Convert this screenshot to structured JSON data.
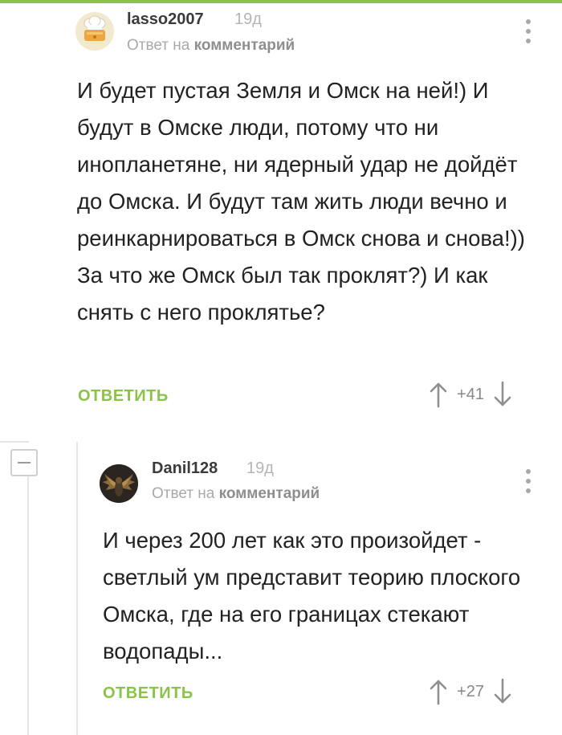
{
  "comments": [
    {
      "author": "lasso2007",
      "time": "19д",
      "reply_prefix": "Ответ на",
      "reply_link": "комментарий",
      "text": "И будет пустая Земля и Омск на ней!) И будут в Омске люди, потому что ни инопланетяне, ни ядерный удар не дойдёт до Омска. И будут там жить люди вечно и реинкарнироваться в Омск снова и снова!)) За что же Омск был так проклят?) И как снять с него проклятье?",
      "reply_button": "ОТВЕТИТЬ",
      "score": "+41",
      "avatar_icon": "chef-hat-avatar-icon"
    },
    {
      "author": "Danil128",
      "time": "19д",
      "reply_prefix": "Ответ на",
      "reply_link": "комментарий",
      "text": "И через 200 лет как это произойдет - светлый ум представит теорию плоского Омска, где на его границах стекают водопады...",
      "reply_button": "ОТВЕТИТЬ",
      "score": "+27",
      "avatar_icon": "winged-creature-avatar-icon"
    }
  ],
  "colors": {
    "accent": "#8bc34a",
    "muted_text": "#a9a9a9",
    "body_text": "#222222",
    "thread_line": "#e6e6e6"
  },
  "icons": {
    "collapse": "minus-icon",
    "more": "kebab-menu-icon",
    "upvote": "arrow-up-icon",
    "downvote": "arrow-down-icon"
  }
}
